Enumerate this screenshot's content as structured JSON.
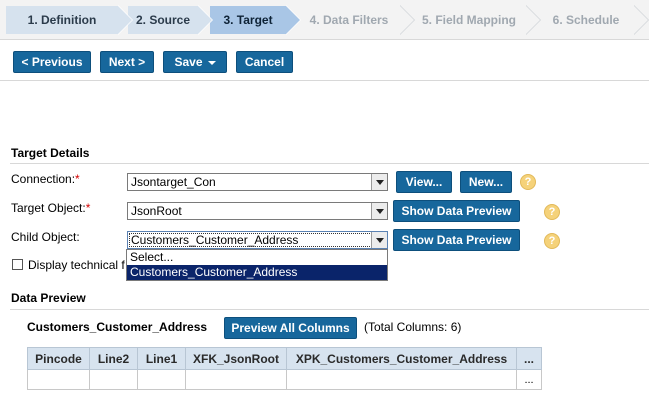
{
  "wizard": {
    "steps": [
      {
        "label": "1. Definition",
        "state": "done"
      },
      {
        "label": "2. Source",
        "state": "done"
      },
      {
        "label": "3. Target",
        "state": "active"
      },
      {
        "label": "4. Data Filters",
        "state": "todo"
      },
      {
        "label": "5. Field Mapping",
        "state": "todo"
      },
      {
        "label": "6. Schedule",
        "state": "todo"
      }
    ]
  },
  "toolbar": {
    "previous_label": "< Previous",
    "next_label": "Next >",
    "save_label": "Save",
    "cancel_label": "Cancel"
  },
  "target_details": {
    "title": "Target Details",
    "connection": {
      "label": "Connection:",
      "required_mark": "*",
      "value": "Jsontarget_Con",
      "view_label": "View...",
      "new_label": "New..."
    },
    "target_object": {
      "label": "Target Object:",
      "required_mark": "*",
      "value": "JsonRoot",
      "preview_label": "Show Data Preview"
    },
    "child_object": {
      "label": "Child Object:",
      "value": "Customers_Customer_Address",
      "preview_label": "Show Data Preview",
      "dropdown_options": [
        "Select...",
        "Customers_Customer_Address"
      ],
      "selected_option": "Customers_Customer_Address"
    },
    "display_technical_label": "Display technical f"
  },
  "data_preview": {
    "title": "Data Preview",
    "object_name": "Customers_Customer_Address",
    "preview_all_label": "Preview All Columns",
    "total_columns_text": "(Total Columns: 6)",
    "columns": [
      "Pincode",
      "Line2",
      "Line1",
      "XFK_JsonRoot",
      "XPK_Customers_Customer_Address",
      "..."
    ],
    "row": [
      "",
      "",
      "",
      "",
      "",
      "..."
    ]
  },
  "help_icon_glyph": "?",
  "colors": {
    "button_blue": "#17679c",
    "active_step": "#a9c6e6",
    "done_step": "#d6e2ee",
    "help_icon": "#f5d27a",
    "selected_option_bg": "#0a246a"
  }
}
